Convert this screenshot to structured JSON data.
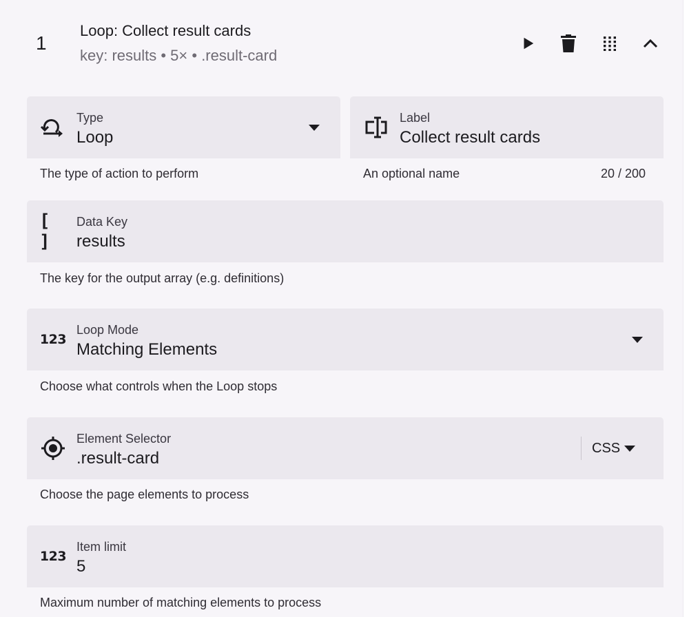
{
  "header": {
    "step_number": "1",
    "title": "Loop: Collect result cards",
    "subtitle": "key: results • 5× • .result-card",
    "actions": [
      {
        "name": "play-icon"
      },
      {
        "name": "trash-icon"
      },
      {
        "name": "drag-handle-icon"
      },
      {
        "name": "chevron-up-icon"
      }
    ]
  },
  "fields": {
    "type": {
      "label": "Type",
      "value": "Loop",
      "hint": "The type of action to perform",
      "icon": "loop-icon"
    },
    "label": {
      "label": "Label",
      "value": "Collect result cards",
      "hint": "An optional name",
      "counter": "20 / 200",
      "icon": "text-cursor-icon"
    },
    "data_key": {
      "label": "Data Key",
      "value": "results",
      "hint": "The key for the output array (e.g. definitions)",
      "icon": "brackets-icon",
      "icon_text": "[ ]"
    },
    "loop_mode": {
      "label": "Loop Mode",
      "value": "Matching Elements",
      "hint": "Choose what controls when the Loop stops",
      "icon": "numeric-icon",
      "icon_text": "123"
    },
    "element_selector": {
      "label": "Element Selector",
      "value": ".result-card",
      "hint": "Choose the page elements to process",
      "icon": "crosshair-icon",
      "selector_type": "CSS"
    },
    "item_limit": {
      "label": "Item limit",
      "value": "5",
      "hint": "Maximum number of matching elements to process",
      "icon": "numeric-icon",
      "icon_text": "123"
    }
  }
}
